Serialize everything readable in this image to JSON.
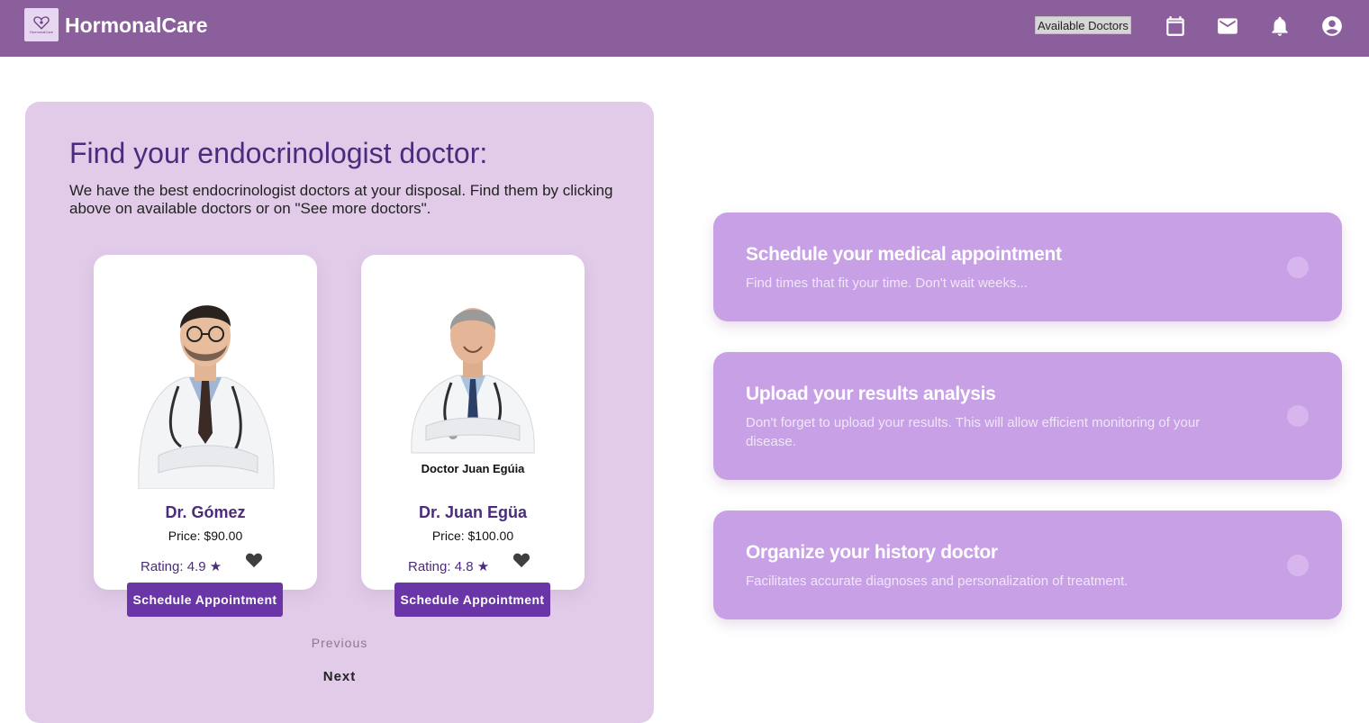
{
  "header": {
    "brand": "HormonalCare",
    "logo_text": "HormonalCare",
    "available_doctors": "Available Doctors",
    "icons": [
      "calendar-icon",
      "mail-icon",
      "bell-icon",
      "account-icon"
    ],
    "bg_color": "#8b5e9c"
  },
  "main": {
    "title": "Find your endocrinologist doctor:",
    "subtitle": "We have the best endocrinologist doctors at your disposal. Find them by clicking above on available doctors or on \"See more doctors\".",
    "doctors": [
      {
        "name": "Dr. Gómez",
        "price": "Price: $90.00",
        "rating": "Rating: 4.9 ★",
        "button": "Schedule Appointment",
        "photo_caption": ""
      },
      {
        "name": "Dr. Juan Egüa",
        "price": "Price: $100.00",
        "rating": "Rating: 4.8 ★",
        "button": "Schedule Appointment",
        "photo_caption": "Doctor Juan Egúia"
      }
    ],
    "previous": "Previous",
    "next": "Next"
  },
  "features": [
    {
      "title": "Schedule your medical appointment",
      "desc": "Find times that fit your time. Don't wait weeks..."
    },
    {
      "title": "Upload your results analysis",
      "desc": "Don't forget to upload your results. This will allow efficient monitoring of your disease."
    },
    {
      "title": "Organize your history doctor",
      "desc": "Facilitates accurate diagnoses and personalization of treatment."
    }
  ],
  "colors": {
    "panel": "#e1cbe8",
    "feature": "#c7a0e5",
    "button": "#6a35a7",
    "title": "#4b2c7c"
  }
}
